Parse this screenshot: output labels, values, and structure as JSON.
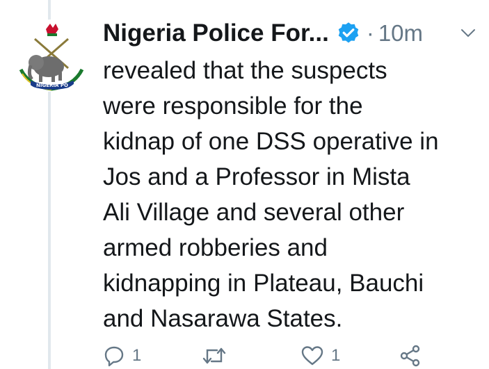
{
  "tweet": {
    "author_name": "Nigeria Police For...",
    "separator": "·",
    "time": "10m",
    "verified_color": "#1da1f2",
    "text_lines": [
      "revealed that the suspects",
      "were responsible for the",
      "kidnap of one DSS operative in",
      "Jos and a Professor in Mista",
      "Ali Village and several other",
      "armed robberies and",
      "kidnapping in Plateau, Bauchi",
      "and Nasarawa States."
    ],
    "avatar_text": "NIGERIA PO",
    "actions": {
      "reply_count": "1",
      "retweet_count": "",
      "like_count": "1"
    },
    "icons": {
      "verified": "verified-badge-icon",
      "more": "chevron-down-icon",
      "reply": "reply-icon",
      "retweet": "retweet-icon",
      "like": "heart-icon",
      "share": "share-icon"
    }
  }
}
